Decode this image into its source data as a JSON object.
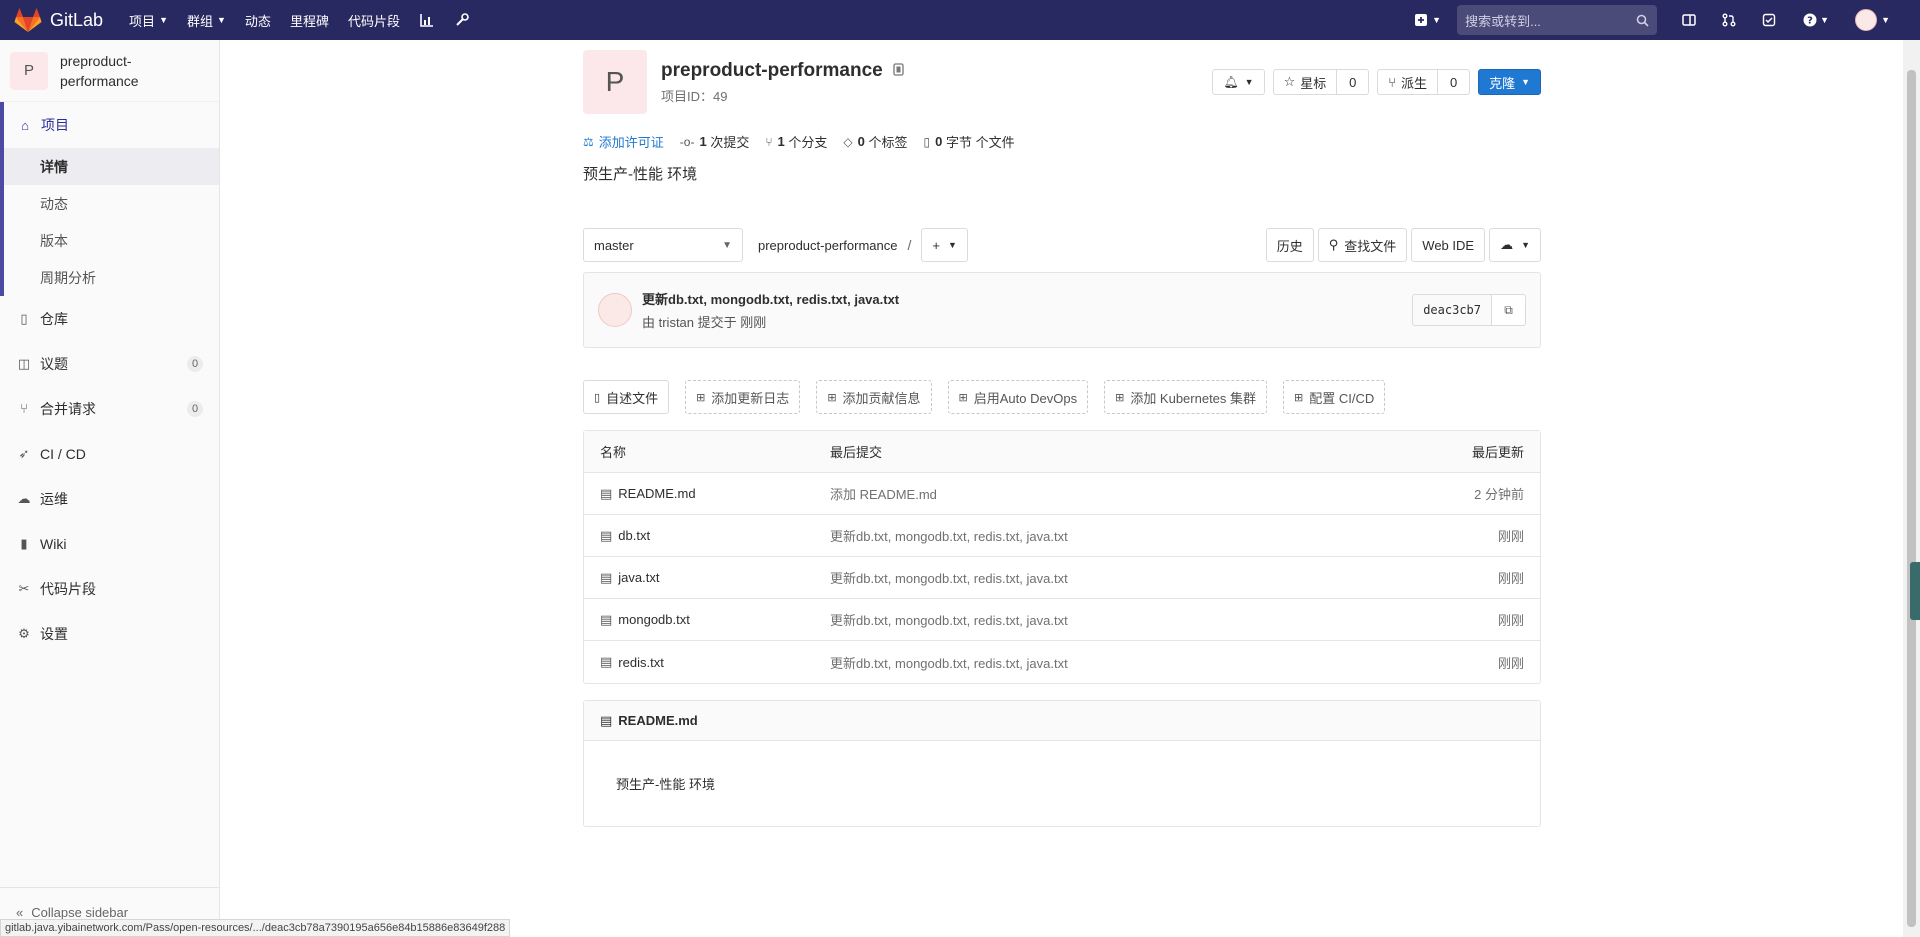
{
  "navbar": {
    "brand": "GitLab",
    "items": [
      {
        "label": "项目",
        "dropdown": true
      },
      {
        "label": "群组",
        "dropdown": true
      },
      {
        "label": "动态",
        "dropdown": false
      },
      {
        "label": "里程碑",
        "dropdown": false
      },
      {
        "label": "代码片段",
        "dropdown": false
      }
    ],
    "search_placeholder": "搜索或转到..."
  },
  "sidebar": {
    "project_initial": "P",
    "project_name": "preproduct-performance",
    "project_label": "项目",
    "sub_items": [
      "详情",
      "动态",
      "版本",
      "周期分析"
    ],
    "items": [
      {
        "label": "仓库",
        "badge": ""
      },
      {
        "label": "议题",
        "badge": "0"
      },
      {
        "label": "合并请求",
        "badge": "0"
      },
      {
        "label": "CI / CD",
        "badge": ""
      },
      {
        "label": "运维",
        "badge": ""
      },
      {
        "label": "Wiki",
        "badge": ""
      },
      {
        "label": "代码片段",
        "badge": ""
      },
      {
        "label": "设置",
        "badge": ""
      }
    ],
    "collapse": "Collapse sidebar"
  },
  "project": {
    "initial": "P",
    "title": "preproduct-performance",
    "id_text": "项目ID：49",
    "notify_caret": "▾",
    "star_label": "星标",
    "star_count": "0",
    "fork_label": "派生",
    "fork_count": "0",
    "clone_label": "克隆",
    "stats": {
      "license": "添加许可证",
      "commits_num": "1",
      "commits_label": "次提交",
      "branches_num": "1",
      "branches_label": "个分支",
      "tags_num": "0",
      "tags_label": "个标签",
      "files_num": "0",
      "files_label": "字节 个文件"
    },
    "description": "预生产-性能 环境"
  },
  "tree": {
    "branch": "master",
    "crumb": "preproduct-performance",
    "sep": "/",
    "add": "+",
    "history": "历史",
    "find_file": "查找文件",
    "web_ide": "Web IDE"
  },
  "commit": {
    "title": "更新db.txt, mongodb.txt, redis.txt, java.txt",
    "meta": "由 tristan 提交于 刚刚",
    "sha": "deac3cb7"
  },
  "shortcuts": [
    "自述文件",
    "添加更新日志",
    "添加贡献信息",
    "启用Auto DevOps",
    "添加 Kubernetes 集群",
    "配置 CI/CD"
  ],
  "files": {
    "headers": {
      "name": "名称",
      "commit": "最后提交",
      "time": "最后更新"
    },
    "rows": [
      {
        "name": "README.md",
        "commit": "添加 README.md",
        "time": "2 分钟前"
      },
      {
        "name": "db.txt",
        "commit": "更新db.txt, mongodb.txt, redis.txt, java.txt",
        "time": "刚刚"
      },
      {
        "name": "java.txt",
        "commit": "更新db.txt, mongodb.txt, redis.txt, java.txt",
        "time": "刚刚"
      },
      {
        "name": "mongodb.txt",
        "commit": "更新db.txt, mongodb.txt, redis.txt, java.txt",
        "time": "刚刚"
      },
      {
        "name": "redis.txt",
        "commit": "更新db.txt, mongodb.txt, redis.txt, java.txt",
        "time": "刚刚"
      }
    ]
  },
  "readme": {
    "title": "README.md",
    "content": "预生产-性能 环境"
  },
  "statusbar": "gitlab.java.yibainetwork.com/Pass/open-resources/.../deac3cb78a7390195a656e84b15886e83649f288",
  "colors": {
    "navbar": "#292961",
    "accent": "#1f78d1",
    "sidebar_active": "#4b4ba3"
  }
}
